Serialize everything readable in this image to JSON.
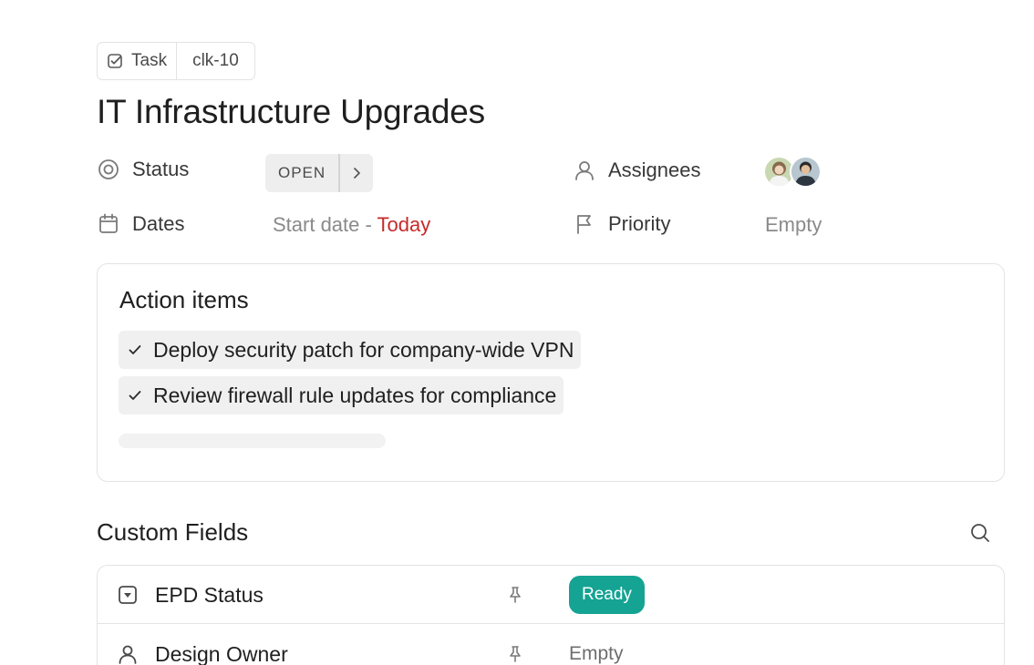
{
  "breadcrumb": {
    "type_label": "Task",
    "id_label": "clk-10"
  },
  "task": {
    "title": "IT Infrastructure Upgrades"
  },
  "properties": {
    "status": {
      "label": "Status",
      "value": "OPEN"
    },
    "dates": {
      "label": "Dates",
      "start_label": "Start date",
      "separator": " - ",
      "due_value": "Today"
    },
    "assignees": {
      "label": "Assignees",
      "count": 2
    },
    "priority": {
      "label": "Priority",
      "value": "Empty"
    }
  },
  "action_items": {
    "title": "Action items",
    "items": [
      {
        "text": "Deploy security patch for company-wide VPN",
        "done": true
      },
      {
        "text": "Review firewall rule updates for compliance",
        "done": true
      }
    ]
  },
  "custom_fields": {
    "title": "Custom Fields",
    "rows": [
      {
        "label": "EPD Status",
        "icon": "dropdown-field-icon",
        "value": "Ready",
        "value_color": "#15a393"
      },
      {
        "label": "Design Owner",
        "icon": "person-field-icon",
        "value": "Empty"
      }
    ]
  },
  "colors": {
    "accent_green": "#15a393",
    "today_red": "#c62a2a"
  }
}
